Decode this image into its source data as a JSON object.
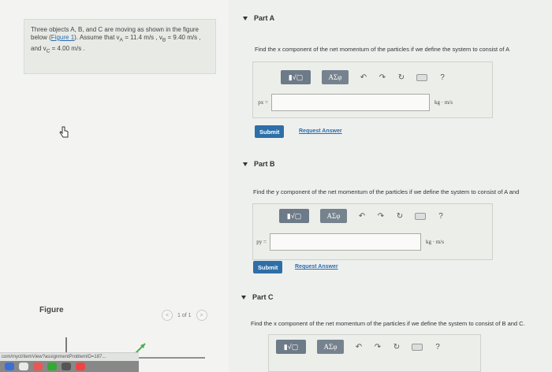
{
  "problem": {
    "text_before_link": "Three objects A, B, and C are moving as shown in the figure below (",
    "link": "Figure 1",
    "text_after_link": "). Assume that v",
    "va_sub": "A",
    "va_value": " = 11.4 m/s , v",
    "vb_sub": "B",
    "vb_value": " = 9.40 m/s , and v",
    "vc_sub": "C",
    "vc_value": " = 4.00 m/s ."
  },
  "figure": {
    "label": "Figure",
    "pager": "1 of 1",
    "prev": "<",
    "next": ">"
  },
  "status_url": "com/myct/itemView?assignmentProblemID=187...",
  "parts": [
    {
      "title": "Part A",
      "question": "Find the x component of the net momentum of the particles if we define the system to consist of A",
      "var_label": "px =",
      "unit": "kg · m/s",
      "submit": "Submit",
      "request": "Request Answer"
    },
    {
      "title": "Part B",
      "question": "Find the y component of the net momentum of the particles if we define the system to consist of A and",
      "var_label": "py =",
      "unit": "kg · m/s",
      "submit": "Submit",
      "request": "Request Answer"
    },
    {
      "title": "Part C",
      "question": "Find the x component of the net momentum of the particles if we define the system to consist of B and C."
    }
  ],
  "toolbar": {
    "math": "▮√▢",
    "greek": "ΑΣφ",
    "undo": "↶",
    "redo": "↷",
    "reset": "↻",
    "help": "?"
  },
  "colors": {
    "submit": "#2d6fa8",
    "link": "#2a6cb0"
  }
}
